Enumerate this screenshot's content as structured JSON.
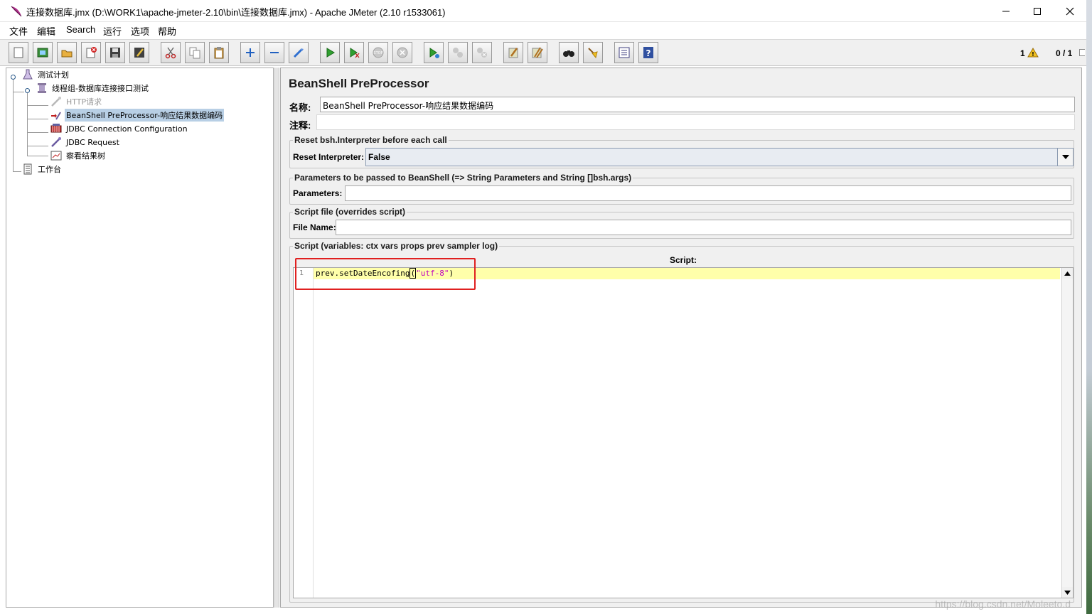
{
  "window": {
    "title": "连接数据库.jmx (D:\\WORK1\\apache-jmeter-2.10\\bin\\连接数据库.jmx) - Apache JMeter (2.10 r1533061)"
  },
  "menu": [
    "文件",
    "编辑",
    "Search",
    "运行",
    "选项",
    "帮助"
  ],
  "toolbar": {
    "buttons": [
      "new-icon",
      "templates-icon",
      "open-icon",
      "close-icon",
      "save-icon",
      "save-as-icon",
      "cut-icon",
      "copy-icon",
      "paste-icon",
      "expand-icon",
      "collapse-icon",
      "toggle-icon",
      "start-icon",
      "start-no-pause-icon",
      "stop-icon",
      "shutdown-icon",
      "remote-start-icon",
      "remote-stop-icon",
      "remote-shutdown-icon",
      "clear-icon",
      "clear-all-icon",
      "search-icon",
      "reset-search-icon",
      "function-helper-icon",
      "help-icon"
    ],
    "warning_count": "1",
    "threads": "0 / 1"
  },
  "tree": {
    "items": [
      {
        "label": "测试计划",
        "icon": "test-plan-icon",
        "level": 0
      },
      {
        "label": "线程组-数据库连接接口测试",
        "icon": "thread-group-icon",
        "level": 1
      },
      {
        "label": "HTTP请求",
        "icon": "sampler-icon",
        "level": 2,
        "disabled": true
      },
      {
        "label": "BeanShell PreProcessor-响应结果数据编码",
        "icon": "preprocessor-icon",
        "level": 2,
        "selected": true
      },
      {
        "label": "JDBC Connection Configuration",
        "icon": "config-element-icon",
        "level": 2
      },
      {
        "label": "JDBC Request",
        "icon": "sampler-icon",
        "level": 2
      },
      {
        "label": "察看结果树",
        "icon": "listener-icon",
        "level": 2
      },
      {
        "label": "工作台",
        "icon": "workbench-icon",
        "level": 0
      }
    ]
  },
  "editor": {
    "title": "BeanShell PreProcessor",
    "name_label": "名称:",
    "name_value": "BeanShell PreProcessor-响应结果数据编码",
    "comment_label": "注释:",
    "comment_value": "",
    "reset_group_title": "Reset bsh.Interpreter before each call",
    "reset_label": "Reset Interpreter:",
    "reset_value": "False",
    "params_group_title": "Parameters to be passed to BeanShell (=> String Parameters and String []bsh.args)",
    "params_label": "Parameters:",
    "params_value": "",
    "file_group_title": "Script file (overrides script)",
    "file_label": "File Name:",
    "file_value": "",
    "script_group_title": "Script (variables: ctx vars props prev sampler log)",
    "script_header": "Script:",
    "script_lines": [
      {
        "num": "1",
        "code": "prev.setDateEncofing",
        "open": "(",
        "string": "\"utf-8\"",
        "close": ")"
      }
    ]
  },
  "watermark": "https://blog.csdn.net/Moleeto.d",
  "colors": {
    "selection": "#b8cfe5",
    "current_line": "#ffffaa",
    "string_literal": "#c000c0",
    "annotation_box": "#e02020"
  }
}
